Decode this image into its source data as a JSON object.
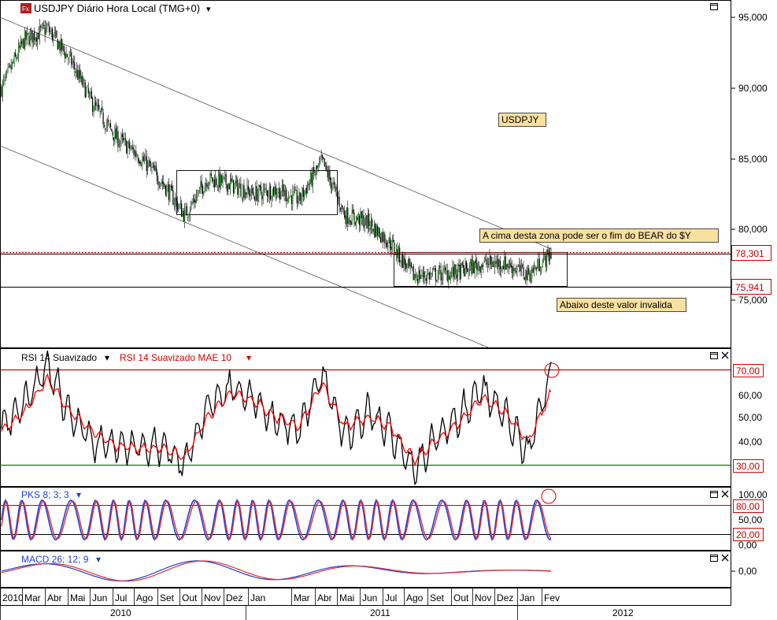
{
  "main": {
    "symbol_badge": "Fx",
    "title": "USDJPY Diário Hora Local (TMG+0)",
    "title_arrow": "▾",
    "watermark": "USDPJY",
    "annotation_top": "A cima desta zona pode ser o fim do BEAR do $Y",
    "annotation_bottom": "Abaixo deste valor invalida",
    "level_high": "78,301",
    "level_low": "75,941",
    "ticks": [
      "95,000",
      "90,000",
      "85,000",
      "80,000",
      "75,000"
    ]
  },
  "rsi": {
    "title_black": "RSI 14 Suavizado",
    "title_red": "RSI 14 Suavizado MAE 10",
    "ticks": [
      "70,00",
      "60,00",
      "50,00",
      "40,00",
      "30,00"
    ]
  },
  "pks": {
    "title": "PKS 8; 3; 3",
    "ticks": [
      "100,00",
      "80,00",
      "50,00",
      "20,00",
      "0,00"
    ]
  },
  "macd": {
    "title": "MACD 26; 12; 9",
    "ticks": [
      "0,00"
    ]
  },
  "time_axis": {
    "months": [
      "2010",
      "Mar",
      "Abr",
      "Mai",
      "Jun",
      "Jul",
      "Ago",
      "Set",
      "Out",
      "Nov",
      "Dez",
      "Jan",
      "Mar",
      "Abr",
      "Mai",
      "Jun",
      "Jul",
      "Ago",
      "Set",
      "Out",
      "Nov",
      "Dez",
      "Jan",
      "Fev"
    ],
    "years": [
      "2010",
      "2011",
      "2012"
    ]
  },
  "colors": {
    "up": "#2e8b2e",
    "down": "#000000",
    "rsi": "#000000",
    "rsi_ma": "#ff0000",
    "overbought": "#d40000",
    "oversold": "#008000",
    "pks_k": "#1f3fd8",
    "pks_d": "#e0302c",
    "level": "#c00000",
    "note_bg": "#f8e0a0"
  },
  "chart_data": [
    {
      "type": "candlestick",
      "title": "USDJPY Diário Hora Local (TMG+0)",
      "ylim": [
        71.5,
        97.5
      ],
      "yticks": [
        95,
        90,
        85,
        80,
        75
      ],
      "x": [
        "2010-02",
        "2010-03",
        "2010-04",
        "2010-05",
        "2010-06",
        "2010-07",
        "2010-08",
        "2010-09",
        "2010-10",
        "2010-11",
        "2010-12",
        "2011-01",
        "2011-02",
        "2011-03",
        "2011-04",
        "2011-05",
        "2011-06",
        "2011-07",
        "2011-08",
        "2011-09",
        "2011-10",
        "2011-11",
        "2011-12",
        "2012-01",
        "2012-02"
      ],
      "close": [
        90.0,
        93.4,
        94.2,
        92.0,
        88.8,
        86.5,
        85.2,
        83.4,
        81.0,
        83.6,
        83.2,
        82.5,
        82.8,
        82.1,
        84.8,
        81.0,
        80.5,
        79.0,
        76.7,
        76.8,
        77.0,
        77.6,
        77.6,
        76.8,
        78.3
      ],
      "annotations": [
        {
          "text": "A cima desta zona pode ser o fim do BEAR do $Y",
          "level": 78.301
        },
        {
          "text": "Abaixo deste valor invalida",
          "level": 75.941
        }
      ],
      "levels": [
        78.301,
        75.941
      ]
    },
    {
      "type": "line",
      "title": "RSI 14 Suavizado",
      "ylim": [
        24,
        76
      ],
      "series": [
        {
          "name": "RSI 14 Suavizado",
          "values": [
            45,
            55,
            72,
            50,
            40,
            38,
            37,
            38,
            30,
            55,
            62,
            58,
            48,
            45,
            68,
            42,
            52,
            44,
            28,
            42,
            50,
            62,
            50,
            35,
            70
          ]
        },
        {
          "name": "RSI 14 Suavizado MAE 10",
          "values": [
            44,
            52,
            66,
            52,
            44,
            38,
            37,
            37,
            33,
            50,
            60,
            57,
            50,
            46,
            64,
            46,
            50,
            46,
            32,
            40,
            48,
            58,
            52,
            40,
            60
          ]
        }
      ],
      "hlines": [
        70,
        30
      ]
    },
    {
      "type": "line",
      "title": "PKS 8; 3; 3",
      "ylim": [
        0,
        100
      ],
      "hlines": [
        80,
        20
      ]
    },
    {
      "type": "line",
      "title": "MACD 26; 12; 9",
      "ylim": [
        -1.5,
        1.5
      ]
    }
  ]
}
